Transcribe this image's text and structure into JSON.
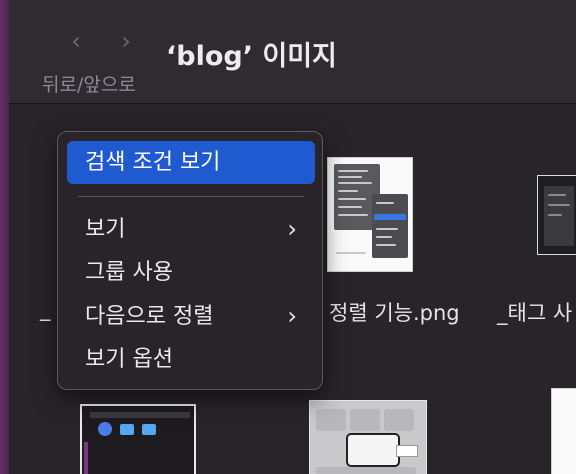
{
  "toolbar": {
    "back_icon": "chevron-left-icon",
    "forward_icon": "chevron-right-icon",
    "nav_label": "뒤로/앞으로",
    "title": "‘blog’ 이미지"
  },
  "files": [
    {
      "name": "_"
    },
    {
      "name": "정렬 기능.png"
    },
    {
      "name": "_태그 사"
    }
  ],
  "context_menu": {
    "items": [
      {
        "label": "검색 조건 보기",
        "selected": true,
        "submenu": false
      },
      {
        "label": "보기",
        "selected": false,
        "submenu": true
      },
      {
        "label": "그룹 사용",
        "selected": false,
        "submenu": false
      },
      {
        "label": "다음으로 정렬",
        "selected": false,
        "submenu": true
      },
      {
        "label": "보기 옵션",
        "selected": false,
        "submenu": false
      }
    ],
    "submenu_icon": "chevron-right-icon"
  },
  "colors": {
    "accent": "#1f5ad1",
    "background": "#28242a",
    "menu_bg": "#28242a"
  }
}
